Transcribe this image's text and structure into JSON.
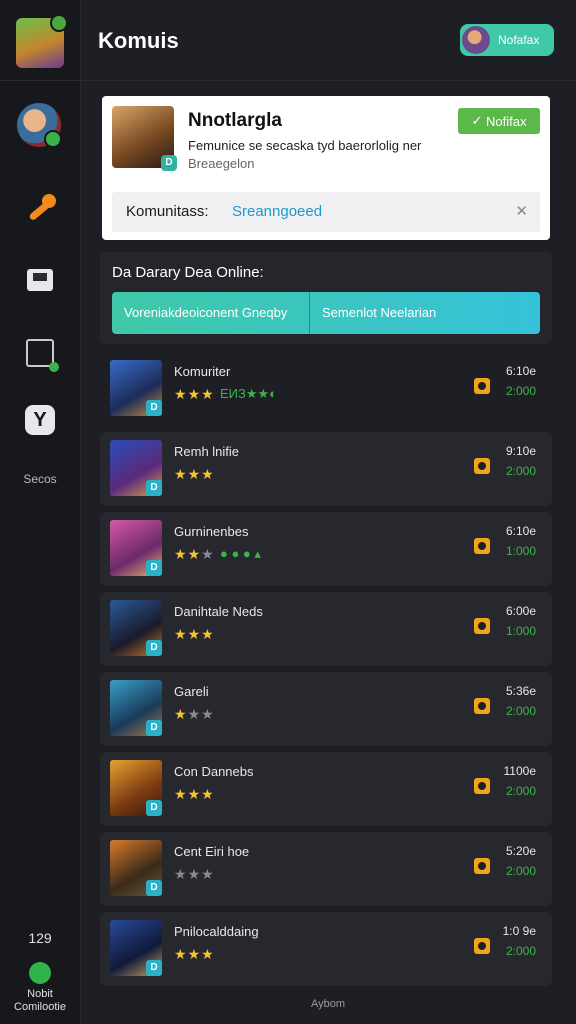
{
  "header": {
    "title": "Komuis",
    "notif_label": "Nofafax"
  },
  "sidebar": {
    "secs_label": "Secos",
    "count": "129",
    "footer_line1": "Nobit",
    "footer_line2": "Comilootie"
  },
  "featured": {
    "name": "Nnotlargla",
    "desc1": "Femunice se secaska tyd baerorlolig ner",
    "desc2": "Breaegelon",
    "button": "Nofifax",
    "comm_label": "Komunitass:",
    "comm_value": "Sreanngoeed"
  },
  "section": {
    "title": "Da Darary Dea Online:",
    "tab1": "Voreniakdeoiconent Gneqby",
    "tab2": "Semenlot Neelarian"
  },
  "games": [
    {
      "name": "Komuriter",
      "stars": 3,
      "extra": "ЕИЗ★★◐",
      "meta1": "6:10e",
      "meta2": "2:000"
    },
    {
      "name": "Remh lnifie",
      "stars": 3,
      "extra": "",
      "meta1": "9:10e",
      "meta2": "2:000"
    },
    {
      "name": "Gurninenbes",
      "stars": 2,
      "extra": "● ● ● ▴",
      "meta1": "6:10e",
      "meta2": "1:000"
    },
    {
      "name": "Danihtale Neds",
      "stars": 3,
      "extra": "",
      "meta1": "6:00e",
      "meta2": "1:000"
    },
    {
      "name": "Gareli",
      "stars": 1,
      "extra": "",
      "meta1": "5:36e",
      "meta2": "2:000"
    },
    {
      "name": "Con Dannebs",
      "stars": 3,
      "extra": "",
      "meta1": "1100e",
      "meta2": "2:000"
    },
    {
      "name": "Cent Eiri hoe",
      "stars": 0,
      "extra": "",
      "meta1": "5:20e",
      "meta2": "2:000"
    },
    {
      "name": "Pnilocalddaing",
      "stars": 3,
      "extra": "",
      "meta1": "1:0 9e",
      "meta2": "2:000"
    }
  ],
  "bottom_label": "Aybom",
  "colors": {
    "accent": "#3fc9a8",
    "green": "#3bb34b",
    "star": "#f2c531"
  }
}
